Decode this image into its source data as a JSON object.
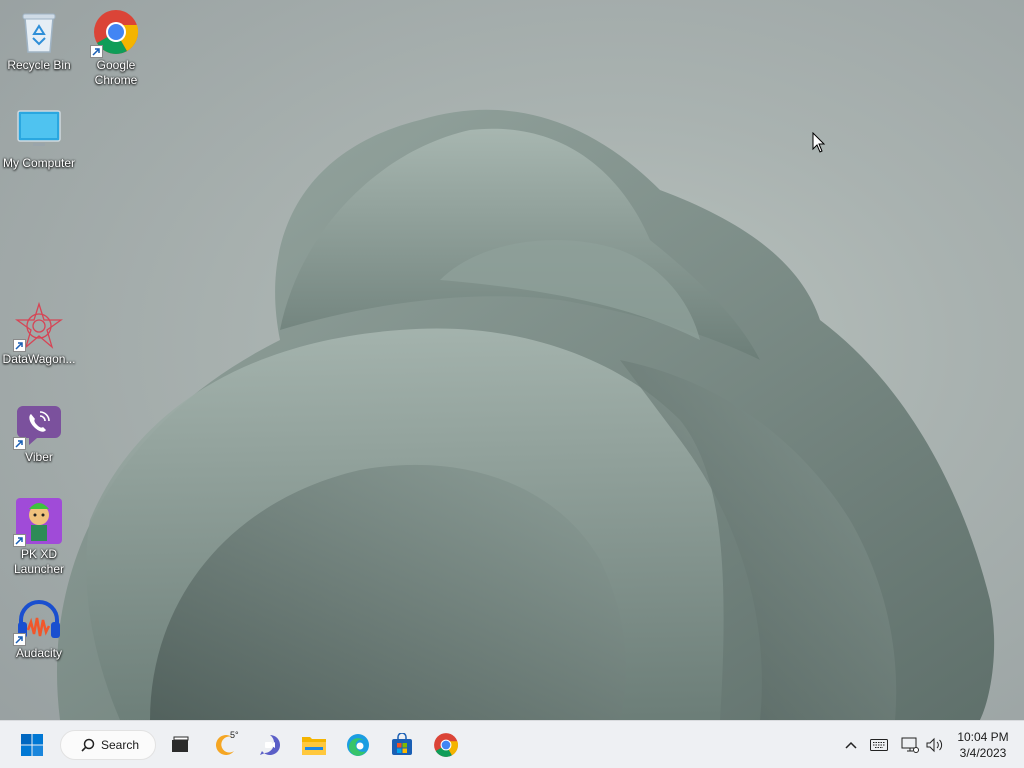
{
  "desktop": {
    "icons": [
      {
        "label": "Recycle Bin",
        "icon": "recycle-bin-icon"
      },
      {
        "label": "Google Chrome",
        "icon": "chrome-icon"
      },
      {
        "label": "My Computer",
        "icon": "monitor-icon"
      },
      {
        "label": "DataWagon...",
        "icon": "datawagon-icon"
      },
      {
        "label": "Viber",
        "icon": "viber-icon"
      },
      {
        "label": "PK XD Launcher",
        "icon": "pkxd-icon"
      },
      {
        "label": "Audacity",
        "icon": "audacity-icon"
      }
    ]
  },
  "taskbar": {
    "search_label": "Search",
    "weather_temp": "5°",
    "pinned": [
      "start-icon",
      "task-view-icon",
      "weather-icon",
      "teams-chat-icon",
      "file-explorer-icon",
      "edge-icon",
      "store-icon",
      "chrome-icon"
    ],
    "clock": {
      "time": "10:04 PM",
      "date": "3/4/2023"
    }
  },
  "colors": {
    "taskbar_bg": "#eef0f3",
    "start_blue": "#0067c0",
    "wallpaper_petal": "#7f918b"
  }
}
